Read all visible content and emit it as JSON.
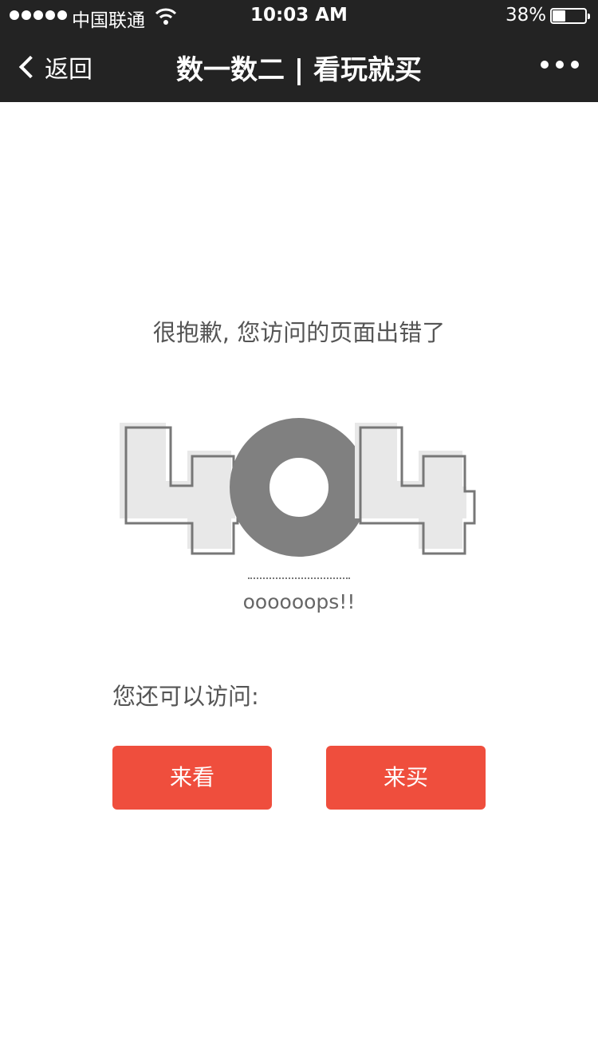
{
  "status_bar": {
    "carrier": "中国联通",
    "time": "10:03 AM",
    "battery": "38%"
  },
  "nav": {
    "back_label": "返回",
    "title": "数一数二 | 看玩就买"
  },
  "error": {
    "message": "很抱歉, 您访问的页面出错了",
    "code": "404",
    "oops": "oooooops!!"
  },
  "suggest": {
    "label": "您还可以访问:",
    "buttons": [
      "来看",
      "来买"
    ]
  },
  "colors": {
    "topbar": "#232323",
    "accent": "#ef4e3d",
    "graphic": "#808080"
  }
}
